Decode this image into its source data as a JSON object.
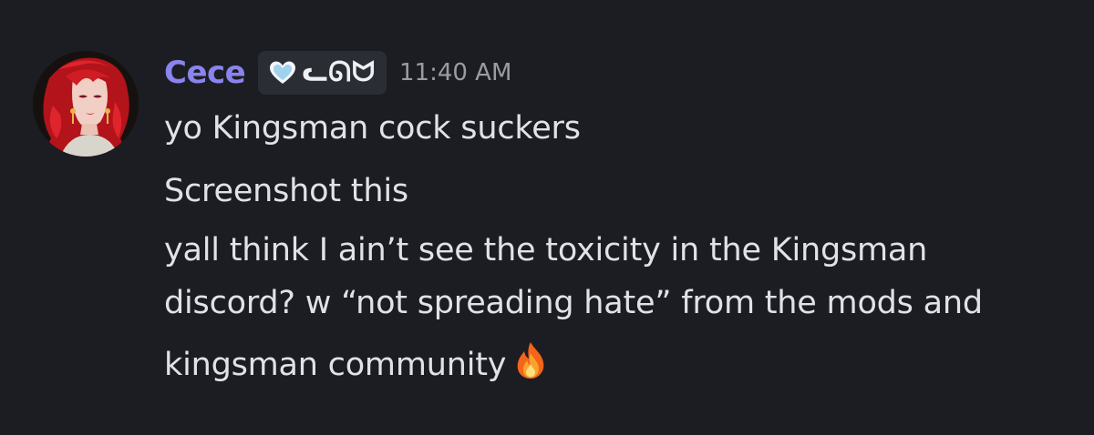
{
  "author": {
    "name": "Cece",
    "name_color": "#8a84ee",
    "avatar_icon": "avatar-anime-red-hair"
  },
  "tag": {
    "icon": "light-blue-heart-icon",
    "text": "ᓚᘏᗢ"
  },
  "timestamp": "11:40 AM",
  "message": {
    "line1": "yo Kingsman cock suckers",
    "line2": "Screenshot this",
    "line3": "yall think I ain’t see the toxicity in the Kingsman",
    "line4": "discord? w “not spreading hate”  from the mods and",
    "line5": "kingsman community",
    "emoji": "fire-emoji"
  },
  "colors": {
    "background": "#1c1d22",
    "text": "#e1e2e6",
    "timestamp": "#9a9ca3",
    "tag_bg": "#2b2d34"
  }
}
